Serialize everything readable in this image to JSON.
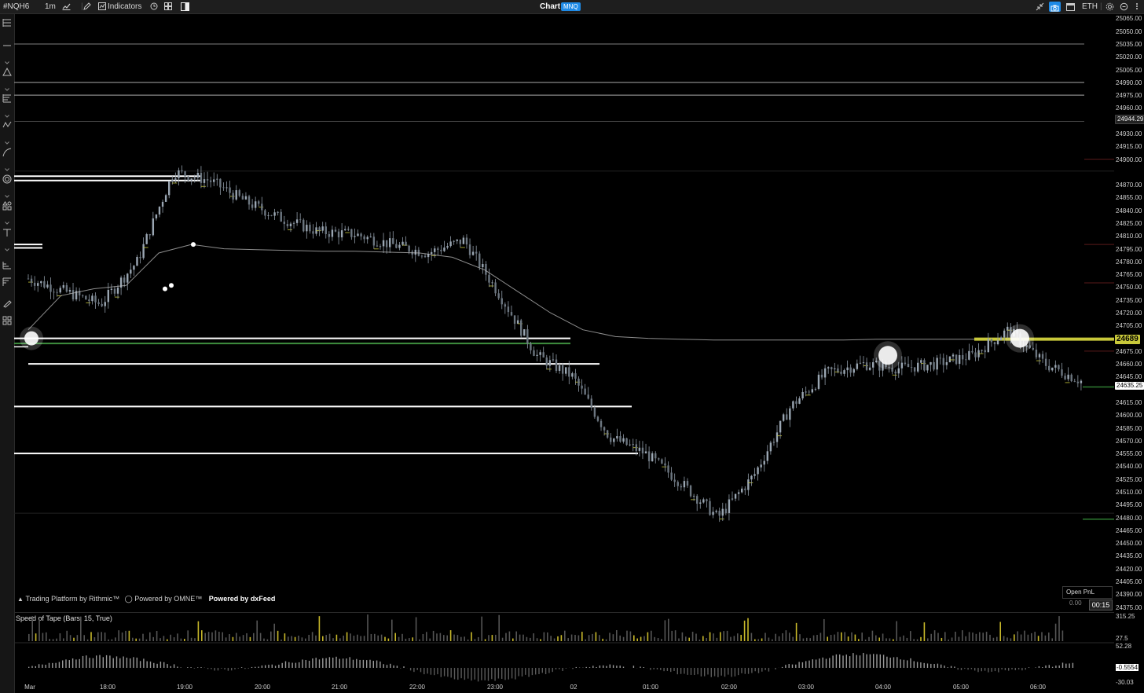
{
  "toolbar": {
    "symbol": "#NQH6",
    "interval": "1m",
    "indicators_label": "Indicators",
    "title": "Chart",
    "badge": "MNQ",
    "session": "ETH"
  },
  "left_tools": [
    "menu-icon",
    "line-icon",
    "triangle-icon",
    "fib-icon",
    "pattern-icon",
    "curve-icon",
    "spiral-icon",
    "shapes-icon",
    "text-icon",
    "long-position-icon",
    "short-position-icon",
    "brush-icon",
    "layers-icon"
  ],
  "price_axis": {
    "labels": [
      "25065.00",
      "25050.00",
      "25035.00",
      "25020.00",
      "25005.00",
      "24990.00",
      "24975.00",
      "24960.00",
      "24930.00",
      "24915.00",
      "24900.00",
      "24870.00",
      "24855.00",
      "24840.00",
      "24825.00",
      "24810.00",
      "24795.00",
      "24780.00",
      "24765.00",
      "24750.00",
      "24735.00",
      "24720.00",
      "24705.00",
      "24675.00",
      "24660.00",
      "24645.00",
      "24615.00",
      "24600.00",
      "24585.00",
      "24570.00",
      "24555.00",
      "24540.00",
      "24525.00",
      "24510.00",
      "24495.00",
      "24480.00",
      "24465.00",
      "24450.00",
      "24435.00",
      "24420.00",
      "24405.00",
      "24390.00",
      "24375.00"
    ],
    "last_price_marker": "24944.29",
    "current_price": "24689",
    "bid_ask_price": "24635.25"
  },
  "watermark": {
    "rithmic": "Trading Platform by Rithmic™",
    "omne": "Powered by OMNE™",
    "dxfeed": "Powered by dxFeed"
  },
  "open_pnl": {
    "label": "Open PnL",
    "value": "0.00"
  },
  "bar_timer": "00:15",
  "indicator": {
    "title": "Speed of Tape (Bars, 15, True)",
    "axis_labels": [
      "315.25",
      "27.5",
      "52.28",
      "-0.5554",
      "-30.03"
    ]
  },
  "time_axis": [
    "Mar",
    "18:00",
    "19:00",
    "20:00",
    "21:00",
    "22:00",
    "23:00",
    "02",
    "01:00",
    "02:00",
    "03:00",
    "04:00",
    "05:00",
    "06:00"
  ],
  "colors": {
    "background": "#000000",
    "toolbar": "#1e1e1e",
    "accent_blue": "#1e8ae6",
    "highlight_yellow": "#c8c83a",
    "candle": "#8f9aa6",
    "vwap": "#bcbcbc"
  },
  "chart_data": {
    "type": "candlestick",
    "symbol": "#NQH6",
    "interval": "1m",
    "ylim": [
      24370,
      25070
    ],
    "x": [
      "17:30",
      "18:00",
      "18:30",
      "19:00",
      "19:10",
      "19:30",
      "20:00",
      "20:30",
      "21:00",
      "21:30",
      "22:00",
      "22:30",
      "23:00",
      "23:30",
      "00:00",
      "00:30",
      "01:00",
      "01:30",
      "02:00",
      "02:15",
      "02:30",
      "03:00",
      "03:30",
      "04:00",
      "04:30",
      "05:00",
      "05:30",
      "05:45",
      "06:00",
      "06:30"
    ],
    "close": [
      24760,
      24745,
      24730,
      24780,
      24885,
      24875,
      24850,
      24830,
      24815,
      24812,
      24800,
      24790,
      24805,
      24740,
      24670,
      24645,
      24575,
      24555,
      24520,
      24480,
      24530,
      24610,
      24650,
      24660,
      24655,
      24660,
      24670,
      24700,
      24660,
      24640
    ],
    "vwap": [
      24700,
      24740,
      24748,
      24752,
      24790,
      24800,
      24795,
      24794,
      24793,
      24792,
      24792,
      24791,
      24790,
      24785,
      24770,
      24745,
      24720,
      24700,
      24692,
      24690,
      24689,
      24688,
      24688,
      24688,
      24688,
      24688,
      24689,
      24689,
      24689,
      24689
    ],
    "horizontal_levels": [
      25035,
      24990,
      24975,
      24944.29,
      24880,
      24875,
      24800,
      24796,
      24690,
      24684,
      24680,
      24660,
      24610,
      24555
    ],
    "highlight_level": 24689
  }
}
